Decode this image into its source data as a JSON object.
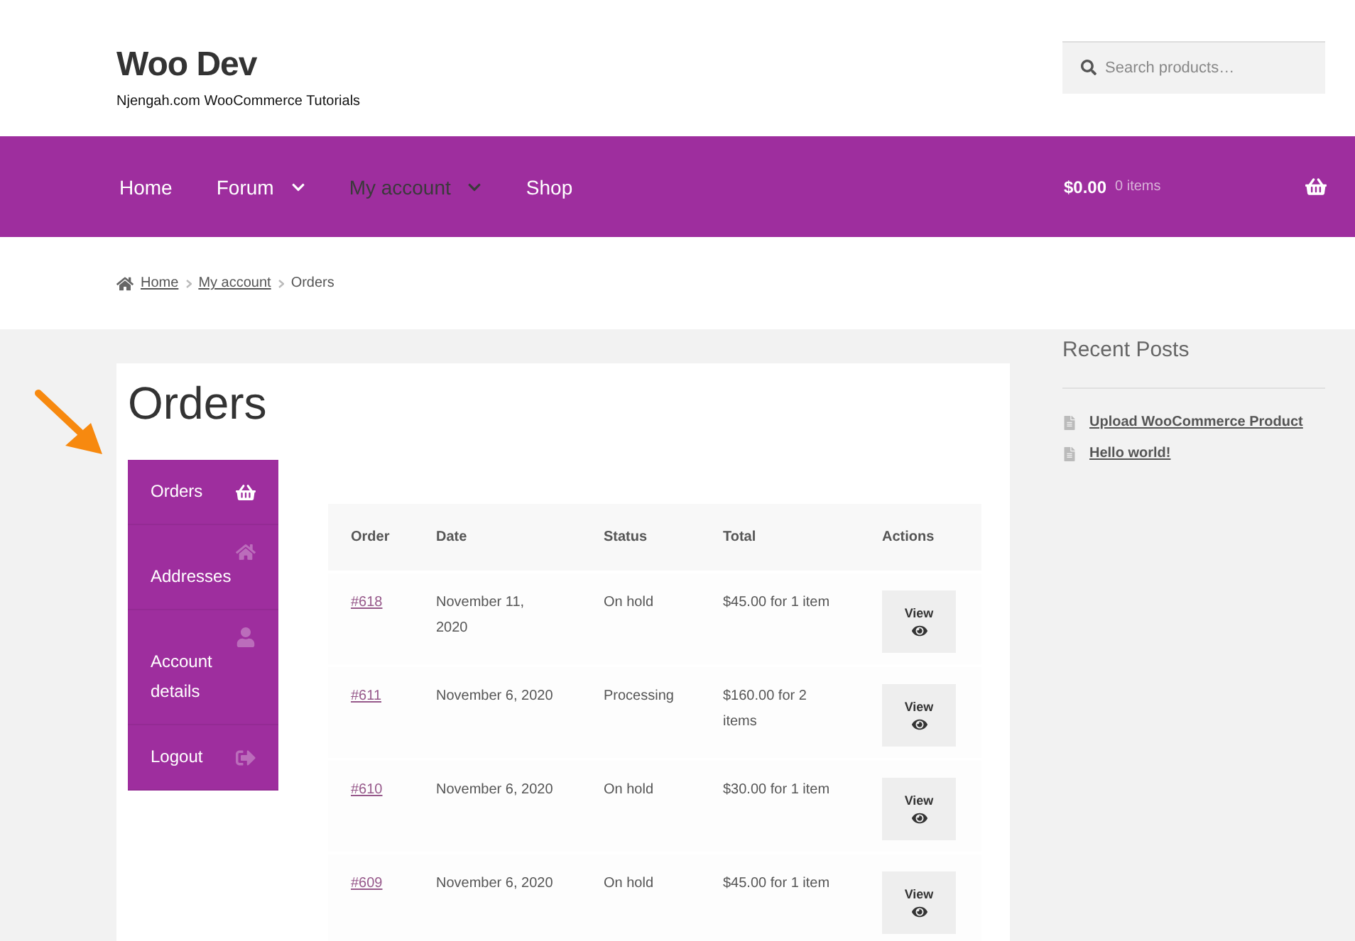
{
  "site": {
    "title": "Woo Dev",
    "tagline": "Njengah.com WooCommerce Tutorials"
  },
  "search": {
    "placeholder": "Search products…"
  },
  "nav": {
    "items": [
      {
        "label": "Home",
        "selected": false,
        "has_submenu": false
      },
      {
        "label": "Forum",
        "selected": false,
        "has_submenu": true
      },
      {
        "label": "My account",
        "selected": true,
        "has_submenu": true
      },
      {
        "label": "Shop",
        "selected": false,
        "has_submenu": false
      }
    ]
  },
  "cart": {
    "total": "$0.00",
    "count": "0 items"
  },
  "breadcrumb": [
    {
      "label": "Home",
      "kind": "link"
    },
    {
      "label": "My account",
      "kind": "link"
    },
    {
      "label": "Orders",
      "kind": "current"
    }
  ],
  "page_title": "Orders",
  "account_menu": [
    {
      "label": "Orders",
      "kind": "orders",
      "selected": true
    },
    {
      "label": "Addresses",
      "kind": "addresses",
      "selected": false
    },
    {
      "label": "Account details",
      "kind": "account",
      "selected": false
    },
    {
      "label": "Logout",
      "kind": "logout",
      "selected": false
    }
  ],
  "table": {
    "columns": [
      "Order",
      "Date",
      "Status",
      "Total",
      "Actions"
    ],
    "rows": [
      {
        "order": "#618",
        "date": "November 11, 2020",
        "status": "On hold",
        "total": "$45.00 for 1 item",
        "action": "View"
      },
      {
        "order": "#611",
        "date": "November 6, 2020",
        "status": "Processing",
        "total": "$160.00 for 2 items",
        "action": "View"
      },
      {
        "order": "#610",
        "date": "November 6, 2020",
        "status": "On hold",
        "total": "$30.00 for 1 item",
        "action": "View"
      },
      {
        "order": "#609",
        "date": "November 6, 2020",
        "status": "On hold",
        "total": "$45.00 for 1 item",
        "action": "View"
      }
    ]
  },
  "recent_posts": {
    "title": "Recent Posts",
    "items": [
      "Upload WooCommerce Product",
      "Hello world!"
    ]
  }
}
